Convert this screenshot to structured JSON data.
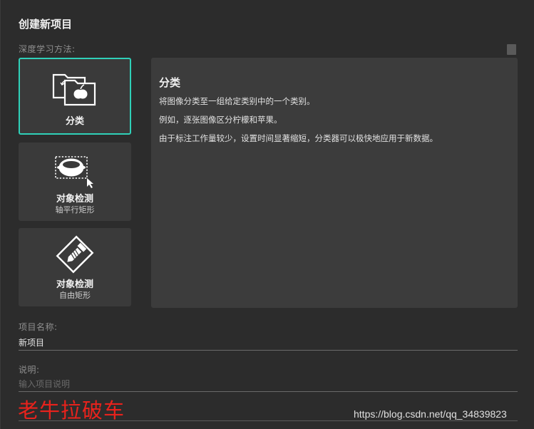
{
  "dialog": {
    "title": "创建新项目",
    "method_label": "深度学习方法:"
  },
  "methods": [
    {
      "label": "分类",
      "sub": "",
      "icon": "classification-icon",
      "selected": true
    },
    {
      "label": "对象检测",
      "sub": "轴平行矩形",
      "icon": "axis-aligned-detection-icon",
      "selected": false
    },
    {
      "label": "对象检测",
      "sub": "自由矩形",
      "icon": "rotated-rectangle-detection-icon",
      "selected": false
    }
  ],
  "description": {
    "title": "分类",
    "lines": [
      "将图像分类至一组给定类别中的一个类别。",
      "例如，逐张图像区分柠檬和苹果。",
      "由于标注工作量较少，设置时间显著缩短，分类器可以极快地应用于新数据。"
    ]
  },
  "project_name": {
    "label": "项目名称:",
    "value": "新项目"
  },
  "project_desc": {
    "label": "说明:",
    "placeholder": "输入项目说明"
  },
  "watermarks": {
    "cn": "老牛拉破车",
    "url": "https://blog.csdn.net/qq_34839823"
  },
  "colors": {
    "accent": "#2fd0b8",
    "background": "#2c2c2c",
    "card": "#3a3a3a",
    "watermark": "#e8221c"
  }
}
